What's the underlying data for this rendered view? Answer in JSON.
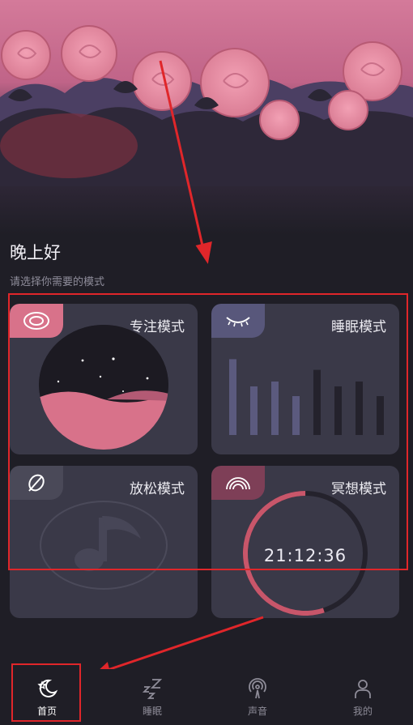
{
  "greeting": {
    "title": "晚上好",
    "subtitle": "请选择你需要的模式"
  },
  "modes": [
    {
      "label": "专注模式",
      "icon": "target-icon",
      "accent": "#d8728a"
    },
    {
      "label": "睡眠模式",
      "icon": "closed-eye-icon",
      "accent": "#58577b"
    },
    {
      "label": "放松模式",
      "icon": "leaf-icon",
      "accent": "#4a4958"
    },
    {
      "label": "冥想模式",
      "icon": "rainbow-icon",
      "accent": "#7e3f57"
    }
  ],
  "meditation": {
    "time": "21:12:36",
    "progress": 0.55
  },
  "sleep_bars": [
    0.78,
    0.5,
    0.55,
    0.4,
    0.67,
    0.5,
    0.55,
    0.4
  ],
  "nav": [
    {
      "label": "首页",
      "icon": "moon-star-icon",
      "active": true
    },
    {
      "label": "睡眠",
      "icon": "zzz-icon",
      "active": false
    },
    {
      "label": "声音",
      "icon": "broadcast-icon",
      "active": false
    },
    {
      "label": "我的",
      "icon": "person-icon",
      "active": false
    }
  ],
  "colors": {
    "background": "#1f1e26",
    "card": "#3a3948",
    "accent_pink": "#d8728a",
    "highlight_red": "#e0262a"
  }
}
